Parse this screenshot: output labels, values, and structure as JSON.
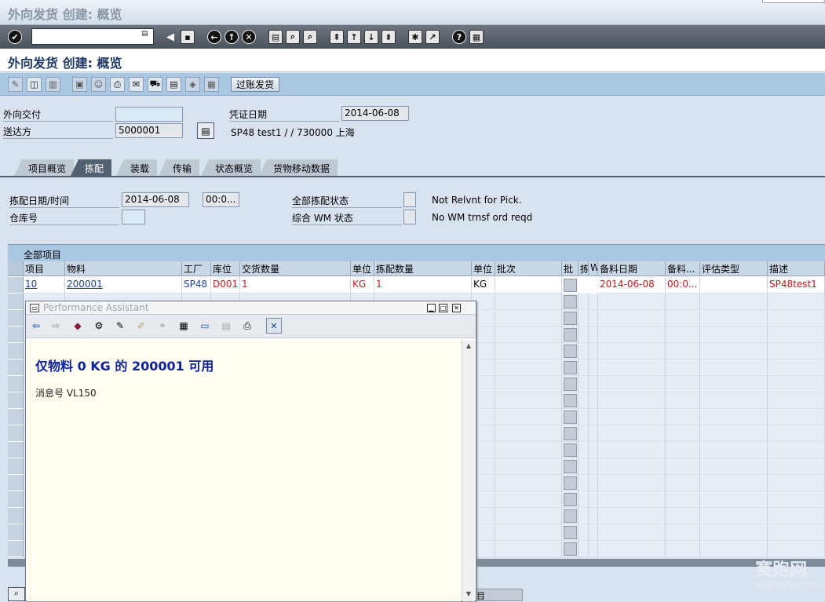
{
  "window": {
    "title": "外向发货 创建: 概览"
  },
  "page": {
    "title": "外向发货 创建: 概览"
  },
  "app_toolbar": {
    "post_goods_issue": "过账发货"
  },
  "header_fields": {
    "outbound_delivery_label": "外向交付",
    "outbound_delivery_value": "",
    "ship_to_label": "送达方",
    "ship_to_value": "5000001",
    "ship_to_address": "SP48 test1 / / 730000 上海",
    "doc_date_label": "凭证日期",
    "doc_date_value": "2014-06-08"
  },
  "tabs": [
    {
      "label": "项目概览",
      "selected": false
    },
    {
      "label": "拣配",
      "selected": true
    },
    {
      "label": "装载",
      "selected": false
    },
    {
      "label": "传输",
      "selected": false
    },
    {
      "label": "状态概览",
      "selected": false
    },
    {
      "label": "货物移动数据",
      "selected": false
    }
  ],
  "picking": {
    "pick_date_label": "拣配日期/时间",
    "pick_date_value": "2014-06-08",
    "pick_time_value": "00:0...",
    "warehouse_label": "仓库号",
    "overall_pick_status_label": "全部拣配状态",
    "overall_pick_status_text": "Not Relvnt for Pick.",
    "overall_wm_status_label": "综合 WM 状态",
    "overall_wm_status_text": "No WM trnsf ord reqd"
  },
  "grid": {
    "title": "全部项目",
    "columns": [
      "项目",
      "物料",
      "工厂",
      "库位",
      "交货数量",
      "单位",
      "拣配数量",
      "单位",
      "批次",
      "批",
      "拣",
      "W",
      "备料日期",
      "备料...",
      "评估类型",
      "描述"
    ],
    "rows": [
      {
        "item": "10",
        "material": "200001",
        "plant": "SP48",
        "sloc": "D001",
        "delivery_qty": "1",
        "unit": "KG",
        "pick_qty": "1",
        "pick_unit": "KG",
        "batch": "",
        "staging_date": "2014-06-08",
        "staging_time": "00:0...",
        "valuation_type": "",
        "description": "SP48test1"
      }
    ]
  },
  "performance_assistant": {
    "title": "Performance Assistant",
    "heading": "仅物料 0 KG 的 200001 可用",
    "message_no": "消息号 VL150"
  },
  "watermark": {
    "text": "赛跑网",
    "url": "www.915ap.com"
  }
}
